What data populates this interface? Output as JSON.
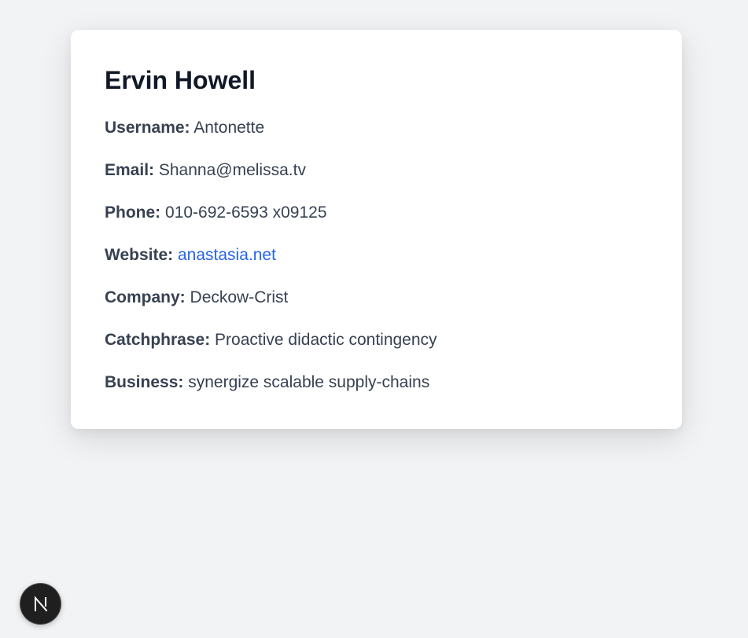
{
  "profile": {
    "name": "Ervin Howell",
    "fields": [
      {
        "label": "Username:",
        "value": "Antonette"
      },
      {
        "label": "Email:",
        "value": "Shanna@melissa.tv"
      },
      {
        "label": "Phone:",
        "value": "010-692-6593 x09125"
      },
      {
        "label": "Website:",
        "value": "anastasia.net"
      },
      {
        "label": "Company:",
        "value": "Deckow-Crist"
      },
      {
        "label": "Catchphrase:",
        "value": "Proactive didactic contingency"
      },
      {
        "label": "Business:",
        "value": "synergize scalable supply-chains"
      }
    ]
  },
  "dev_badge": {
    "icon": "nextjs-logo-icon",
    "letter": "N"
  },
  "colors": {
    "page_background": "#f2f3f5",
    "card_background": "#ffffff",
    "heading": "#111827",
    "text": "#374151",
    "link": "#2563eb",
    "badge_background": "#1f1f1f"
  }
}
